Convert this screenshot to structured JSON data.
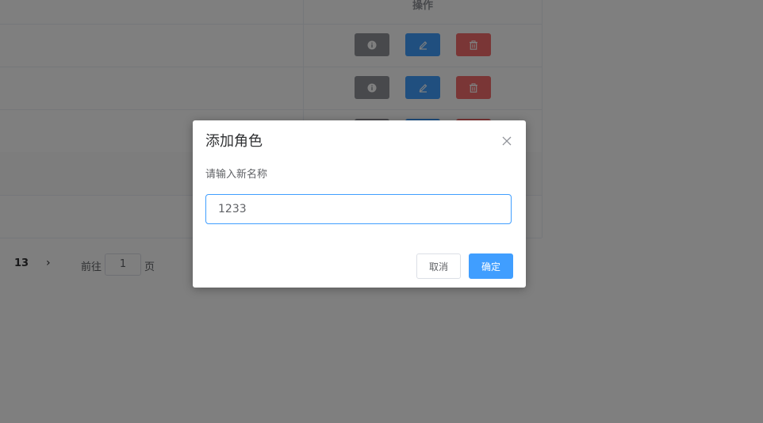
{
  "table": {
    "header": {
      "operations_label": "操作"
    },
    "rows": [
      {
        "actions": [
          "info-icon",
          "edit-icon",
          "delete-icon"
        ]
      },
      {
        "actions": [
          "info-icon",
          "edit-icon",
          "delete-icon"
        ]
      },
      {
        "actions": [
          "info-icon",
          "edit-icon",
          "delete-icon"
        ]
      },
      {
        "actions": []
      },
      {
        "actions": []
      }
    ]
  },
  "pagination": {
    "current_page": "13",
    "next_icon": "chevron-right-icon",
    "goto_label": "前往",
    "goto_value": "1",
    "page_unit": "页"
  },
  "dialog": {
    "title": "添加角色",
    "message": "请输入新名称",
    "input_value": "1233",
    "cancel_label": "取消",
    "confirm_label": "确定"
  },
  "colors": {
    "primary": "#409eff",
    "info": "#909399",
    "danger": "#f56c6c"
  }
}
